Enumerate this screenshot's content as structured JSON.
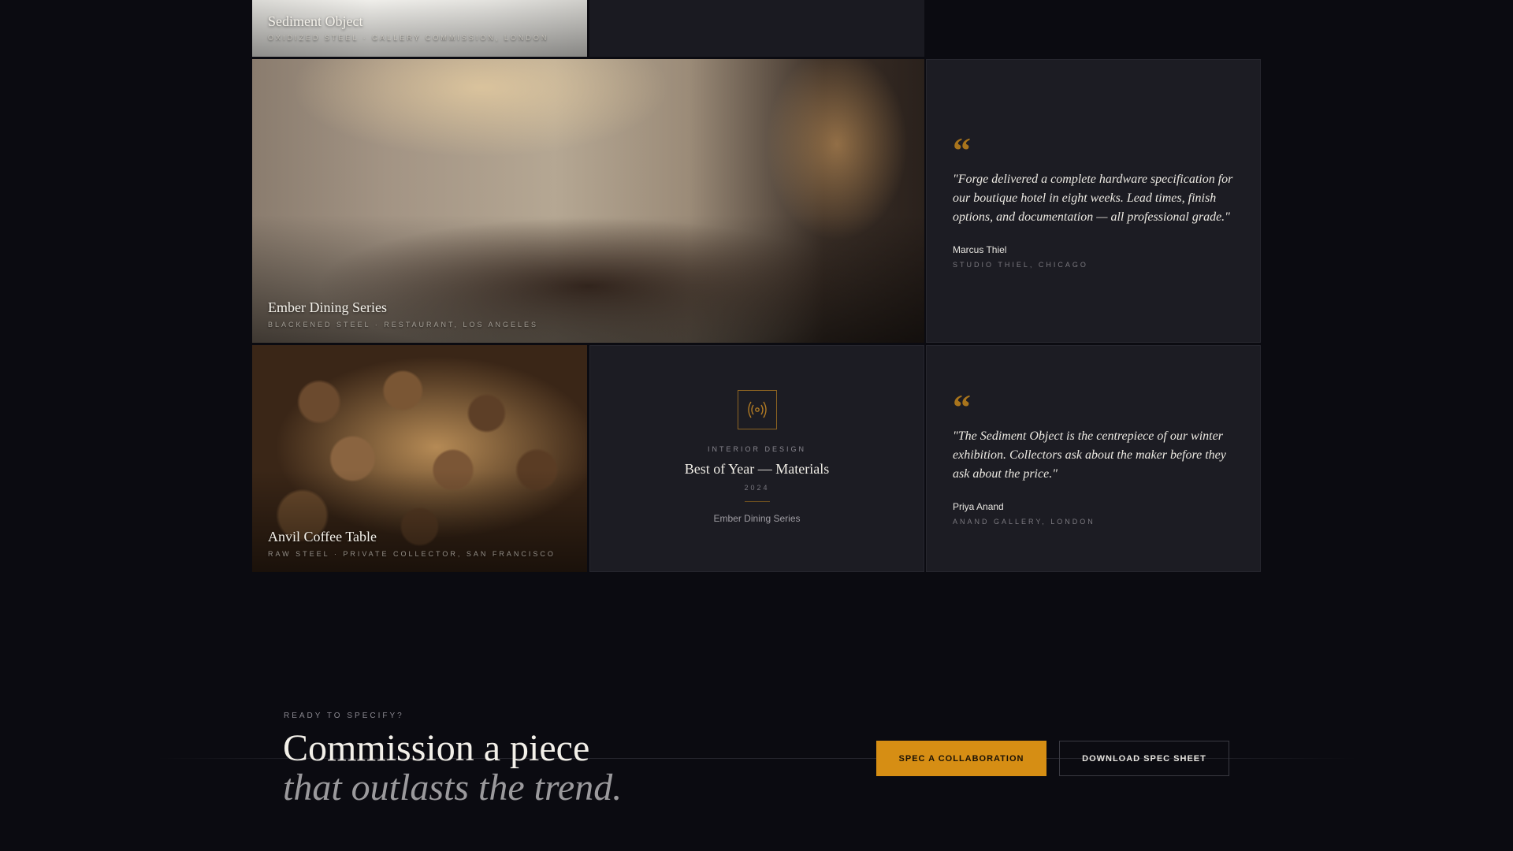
{
  "projects": [
    {
      "title": "Sediment Object",
      "subtitle": "Oxidized Steel · Gallery Commission, London"
    },
    {
      "title": "Ember Dining Series",
      "subtitle": "Blackened Steel · Restaurant, Los Angeles"
    },
    {
      "title": "Anvil Coffee Table",
      "subtitle": "Raw Steel · Private Collector, San Francisco"
    }
  ],
  "testimonials": [
    {
      "quote_icon": "quote-icon",
      "text": "\"Forge delivered a complete hardware specification for our boutique hotel in eight weeks. Lead times, finish options, and documentation — all professional grade.\"",
      "name": "Marcus Thiel",
      "firm": "Studio Thiel, Chicago"
    },
    {
      "quote_icon": "quote-icon",
      "text": "\"The Sediment Object is the centrepiece of our winter exhibition. Collectors ask about the maker before they ask about the price.\"",
      "name": "Priya Anand",
      "firm": "Anand Gallery, London"
    }
  ],
  "award": {
    "icon": "award-icon",
    "category": "Interior Design",
    "title": "Best of Year — Materials",
    "year": "2024",
    "project": "Ember Dining Series"
  },
  "cta": {
    "eyebrow": "Ready to specify?",
    "headline": "Commission a piece",
    "headline_italic": "that outlasts the trend.",
    "primary_label": "Spec a Collaboration",
    "secondary_label": "Download Spec Sheet"
  },
  "colors": {
    "background": "#0b0b11",
    "card": "#1c1c23",
    "accent": "#d68e14",
    "quote_accent": "#a8741c"
  }
}
